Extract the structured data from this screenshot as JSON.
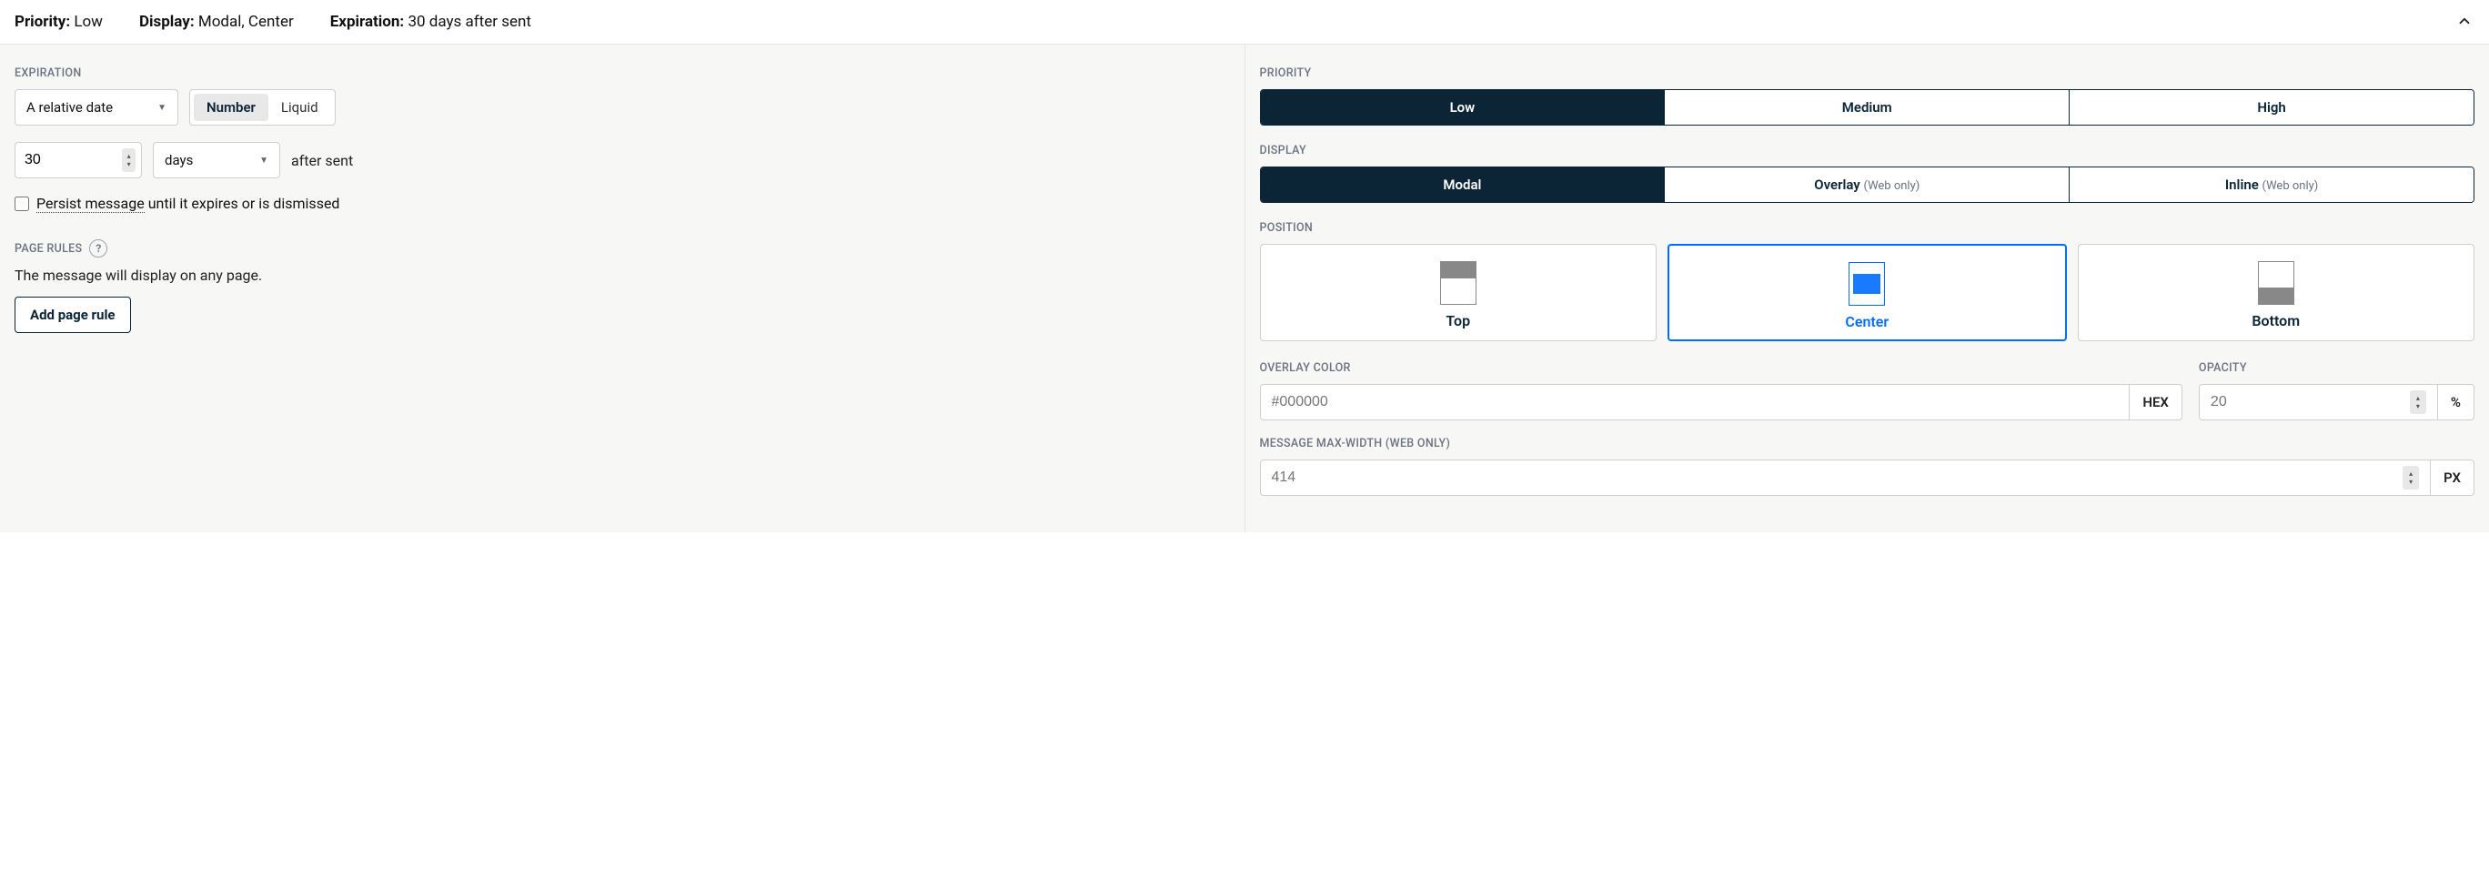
{
  "header": {
    "priority_label": "Priority:",
    "priority_value": "Low",
    "display_label": "Display:",
    "display_value": "Modal, Center",
    "expiration_label": "Expiration:",
    "expiration_value": "30 days after sent"
  },
  "expiration": {
    "section_label": "EXPIRATION",
    "mode_value": "A relative date",
    "format_number": "Number",
    "format_liquid": "Liquid",
    "count_value": "30",
    "unit_value": "days",
    "after_sent": "after sent",
    "persist_link": "Persist message",
    "persist_rest": " until it expires or is dismissed"
  },
  "page_rules": {
    "section_label": "PAGE RULES",
    "help_glyph": "?",
    "description": "The message will display on any page.",
    "add_button": "Add page rule"
  },
  "priority": {
    "section_label": "PRIORITY",
    "options": {
      "low": "Low",
      "medium": "Medium",
      "high": "High"
    }
  },
  "display": {
    "section_label": "DISPLAY",
    "modal": "Modal",
    "overlay": "Overlay",
    "overlay_hint": "(Web only)",
    "inline": "Inline",
    "inline_hint": "(Web only)"
  },
  "position": {
    "section_label": "POSITION",
    "top": "Top",
    "center": "Center",
    "bottom": "Bottom"
  },
  "overlay_color": {
    "section_label": "OVERLAY COLOR",
    "placeholder": "#000000",
    "unit": "HEX"
  },
  "opacity": {
    "section_label": "OPACITY",
    "placeholder": "20",
    "unit": "%"
  },
  "max_width": {
    "section_label": "MESSAGE MAX-WIDTH (WEB ONLY)",
    "placeholder": "414",
    "unit": "PX"
  }
}
